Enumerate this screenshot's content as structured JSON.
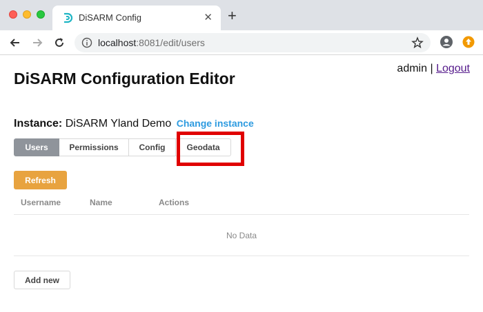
{
  "browser": {
    "tab_title": "DiSARM Config",
    "url_host": "localhost",
    "url_rest": ":8081/edit/users"
  },
  "header": {
    "title": "DiSARM Configuration Editor",
    "username": "admin",
    "separator": "|",
    "logout_label": "Logout"
  },
  "instance": {
    "label": "Instance:",
    "name": "DiSARM Yland Demo",
    "change_label": "Change instance"
  },
  "tabs": [
    {
      "label": "Users",
      "active": true
    },
    {
      "label": "Permissions",
      "active": false
    },
    {
      "label": "Config",
      "active": false
    },
    {
      "label": "Geodata",
      "active": false
    }
  ],
  "actions": {
    "refresh_label": "Refresh",
    "add_new_label": "Add new"
  },
  "table": {
    "columns": [
      "Username",
      "Name",
      "Actions"
    ],
    "empty_text": "No Data"
  },
  "colors": {
    "active_tab": "#8f949b",
    "refresh_button": "#e8a33f",
    "link": "#2d9be0",
    "highlight": "#e00000"
  }
}
